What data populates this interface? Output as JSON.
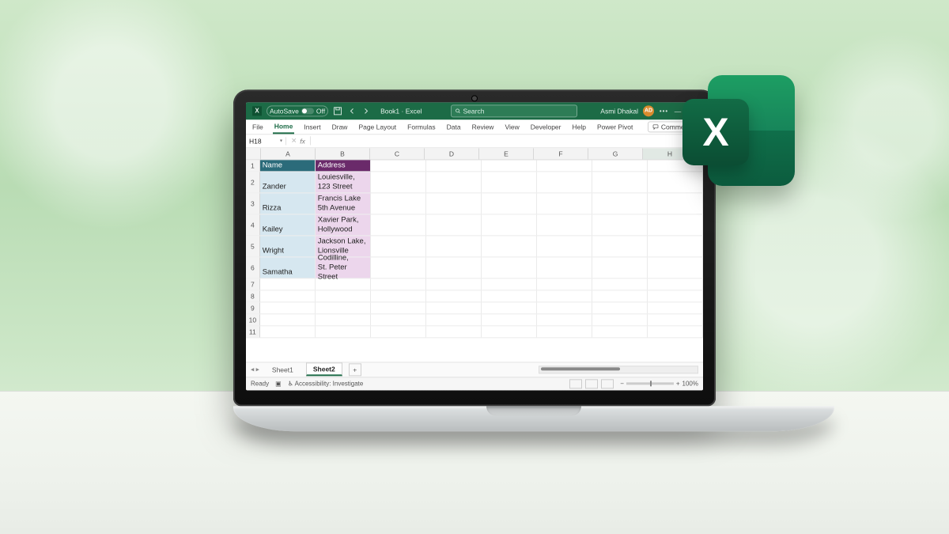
{
  "titlebar": {
    "autosave_label": "AutoSave",
    "autosave_state": "Off",
    "doc": "Book1 · Excel",
    "search_placeholder": "Search",
    "user_name": "Asmi Dhakal",
    "user_initials": "AD"
  },
  "ribbon_tabs": [
    "File",
    "Home",
    "Insert",
    "Draw",
    "Page Layout",
    "Formulas",
    "Data",
    "Review",
    "View",
    "Developer",
    "Help",
    "Power Pivot"
  ],
  "ribbon_right": {
    "comments": "Comments"
  },
  "formula_bar": {
    "namebox": "H18",
    "fx": "fx"
  },
  "columns": [
    "A",
    "B",
    "C",
    "D",
    "E",
    "F",
    "G",
    "H"
  ],
  "selected_column": "H",
  "header_row": {
    "a": "Name",
    "b": "Address"
  },
  "data_rows": [
    {
      "n": "2",
      "a": "Zander",
      "b1": "Louiesville,",
      "b2": "123 Street"
    },
    {
      "n": "3",
      "a": "Rizza",
      "b1": "Francis Lake",
      "b2": "5th Avenue"
    },
    {
      "n": "4",
      "a": "Kailey",
      "b1": "Xavier Park,",
      "b2": "Hollywood"
    },
    {
      "n": "5",
      "a": "Wright",
      "b1": "Jackson Lake,",
      "b2": "Lionsville"
    },
    {
      "n": "6",
      "a": "Samatha",
      "b1": "Codilline,",
      "b2": "St. Peter Street"
    }
  ],
  "empty_rows": [
    "7",
    "8",
    "9",
    "10",
    "11"
  ],
  "sheets": {
    "inactive": "Sheet1",
    "active": "Sheet2"
  },
  "status": {
    "ready": "Ready",
    "access": "Accessibility: Investigate",
    "zoom": "100%"
  },
  "excel_logo_letter": "X"
}
